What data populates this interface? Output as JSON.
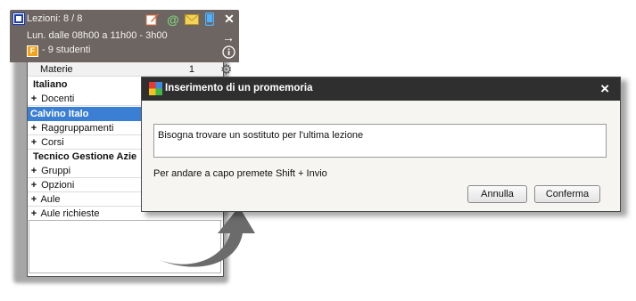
{
  "panel": {
    "header": {
      "title": "Lezioni: 8 / 8",
      "schedule": "Lun. dalle 08h00 a 11h00 - 3h00",
      "badge": "F",
      "students": "- 9 studenti",
      "icons": [
        "edit-icon",
        "at-icon",
        "mail-icon",
        "phone-icon",
        "close-icon",
        "arrow-right-icon",
        "info-icon",
        "gear-icon"
      ]
    },
    "rows": [
      {
        "kind": "subject",
        "label": "Materie",
        "count": "1"
      },
      {
        "kind": "section",
        "label": "Italiano"
      },
      {
        "kind": "expand",
        "label": "Docenti"
      },
      {
        "kind": "selected",
        "label": "Calvino Italo"
      },
      {
        "kind": "expand",
        "label": "Raggruppamenti"
      },
      {
        "kind": "expand",
        "label": "Corsi"
      },
      {
        "kind": "section",
        "label": "Tecnico Gestione Azie"
      },
      {
        "kind": "expand",
        "label": "Gruppi"
      },
      {
        "kind": "expand",
        "label": "Opzioni"
      },
      {
        "kind": "expand",
        "label": "Aule"
      },
      {
        "kind": "expand",
        "label": "Aule richieste"
      }
    ]
  },
  "dialog": {
    "title": "Inserimento di un promemoria",
    "input_value": "Bisogna trovare un sostituto per l'ultima lezione",
    "hint": "Per andare a capo premete Shift + Invio",
    "cancel_label": "Annulla",
    "confirm_label": "Conferma"
  },
  "colors": {
    "header_bg": "#6d6561",
    "selected_bg": "#3a7fd4",
    "dialog_title_bg": "#2f2f2f",
    "arrow": "#6b6b6b"
  }
}
